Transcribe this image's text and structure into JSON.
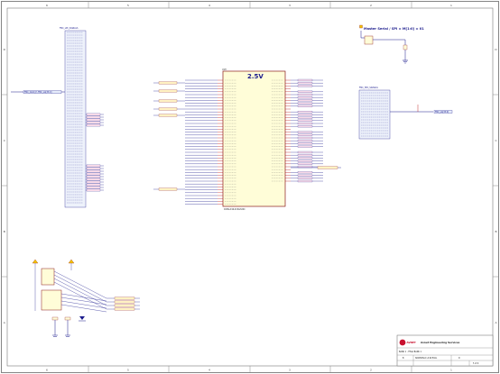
{
  "sheet": {
    "zone_numbers": [
      "1",
      "2",
      "3",
      "4",
      "5",
      "6"
    ],
    "zone_letters": [
      "A",
      "B",
      "C",
      "D"
    ]
  },
  "fpga": {
    "supply_label": "2.5V",
    "part_label": "XC6SLX16-2CSG324C",
    "ref": "U1H"
  },
  "left_connector": {
    "header": "FMC_LPC_SIGNALS",
    "external_net": "FMC_CLK0_P, FMC_LA[33:0]"
  },
  "right_connector": {
    "header": "FMC_HPC_SIGNALS",
    "output_net": "FMC_LA[33:0]"
  },
  "config_block": {
    "title": "Master Serial / SPI = M[1:0] = 01"
  },
  "title_block": {
    "company": "Avnet Engineering Services",
    "logo": "AVNET",
    "sheet_title": "BANK 1 - FPGA BANK 1",
    "doc_number": "SPARTAN-6 LX16 EVAL",
    "size": "B",
    "rev": "D",
    "sheet_of": "5 of 9"
  },
  "colors": {
    "wire": "#1a1a8c",
    "component_fill": "#fffdd8",
    "component_border": "#8b1a1a",
    "net_label_fill": "#fff2c2",
    "pin": "#b00000",
    "border": "#555555"
  }
}
